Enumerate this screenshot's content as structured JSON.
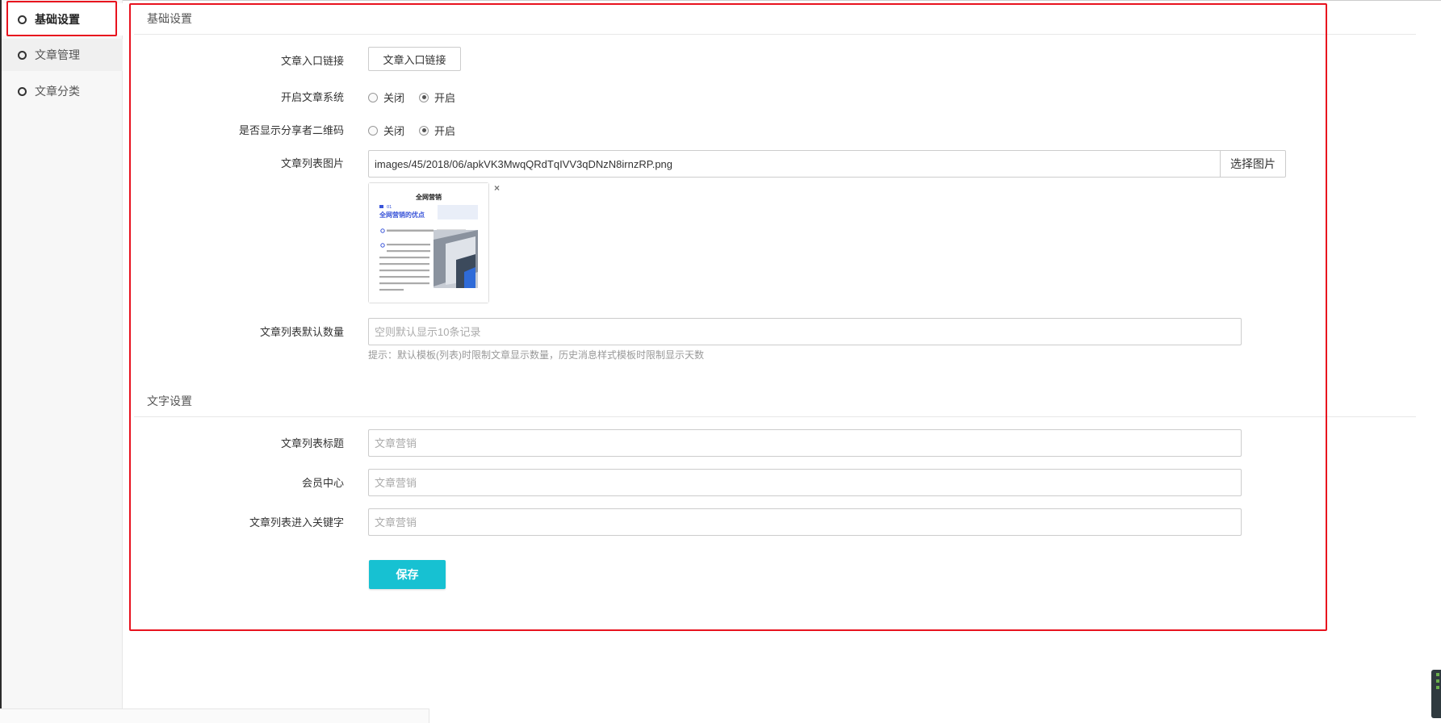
{
  "sidebar": {
    "items": [
      {
        "label": "基础设置",
        "active": true
      },
      {
        "label": "文章管理",
        "active": false
      },
      {
        "label": "文章分类",
        "active": false
      }
    ]
  },
  "sections": {
    "basic_title": "基础设置",
    "text_title": "文字设置"
  },
  "form": {
    "entry_link": {
      "label": "文章入口链接",
      "button": "文章入口链接"
    },
    "enable_system": {
      "label": "开启文章系统",
      "options": [
        "关闭",
        "开启"
      ],
      "selected": "开启"
    },
    "show_qr": {
      "label": "是否显示分享者二维码",
      "options": [
        "关闭",
        "开启"
      ],
      "selected": "开启"
    },
    "list_image": {
      "label": "文章列表图片",
      "value": "images/45/2018/06/apkVK3MwqQRdTqIVV3qDNzN8irnzRP.png",
      "button": "选择图片",
      "remove": "×",
      "thumb": {
        "heading": "全网营销",
        "num": "01",
        "title": "全网营销的优点"
      }
    },
    "default_count": {
      "label": "文章列表默认数量",
      "placeholder": "空则默认显示10条记录",
      "hint": "提示：默认模板(列表)时限制文章显示数量，历史消息样式模板时限制显示天数"
    },
    "list_title": {
      "label": "文章列表标题",
      "placeholder": "文章营销"
    },
    "member_center": {
      "label": "会员中心",
      "placeholder": "文章营销"
    },
    "keyword": {
      "label": "文章列表进入关键字",
      "placeholder": "文章营销"
    },
    "save": "保存"
  },
  "colors": {
    "accent": "#17c1d2",
    "highlight": "#e8121e"
  }
}
